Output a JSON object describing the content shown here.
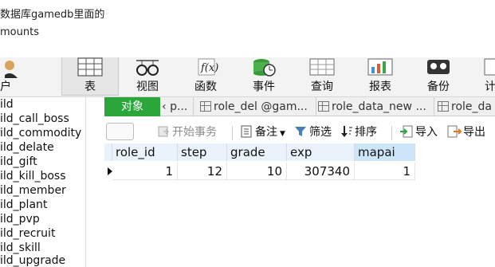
{
  "caption": {
    "line1": "数据库gamedb里面的",
    "line2": "mounts"
  },
  "toolbar": {
    "items": [
      {
        "label": "户",
        "icon": "user-icon"
      },
      {
        "label": "表",
        "icon": "table-icon",
        "active": true
      },
      {
        "label": "视图",
        "icon": "view-glasses-icon"
      },
      {
        "label": "函数",
        "icon": "function-icon"
      },
      {
        "label": "事件",
        "icon": "event-clock-icon"
      },
      {
        "label": "查询",
        "icon": "query-grid-icon"
      },
      {
        "label": "报表",
        "icon": "report-icon"
      },
      {
        "label": "备份",
        "icon": "backup-icon"
      },
      {
        "label": "计",
        "icon": "schedule-icon"
      }
    ]
  },
  "tree": {
    "items": [
      "ild",
      "ild_call_boss",
      "ild_commodity",
      "ild_delate",
      "ild_gift",
      "ild_kill_boss",
      "ild_member",
      "ild_plant",
      "ild_pvp",
      "ild_recruit",
      "ild_skill",
      "ild_upgrade"
    ]
  },
  "tabs": {
    "object_label": "对象",
    "nav_back": "‹",
    "items": [
      "p...",
      "role_del @gam...",
      "role_data_new ...",
      "role_da"
    ]
  },
  "table_tools": {
    "begin_transaction": "开始事务",
    "notes": "备注",
    "filter": "筛选",
    "sort": "排序",
    "import": "导入",
    "export": "导出"
  },
  "grid": {
    "columns": [
      "role_id",
      "step",
      "grade",
      "exp",
      "mapai"
    ],
    "rows": [
      [
        "1",
        "12",
        "10",
        "307340",
        "1"
      ]
    ]
  },
  "colors": {
    "accent_green": "#2aa63a",
    "header_selected": "#cde6f7"
  }
}
